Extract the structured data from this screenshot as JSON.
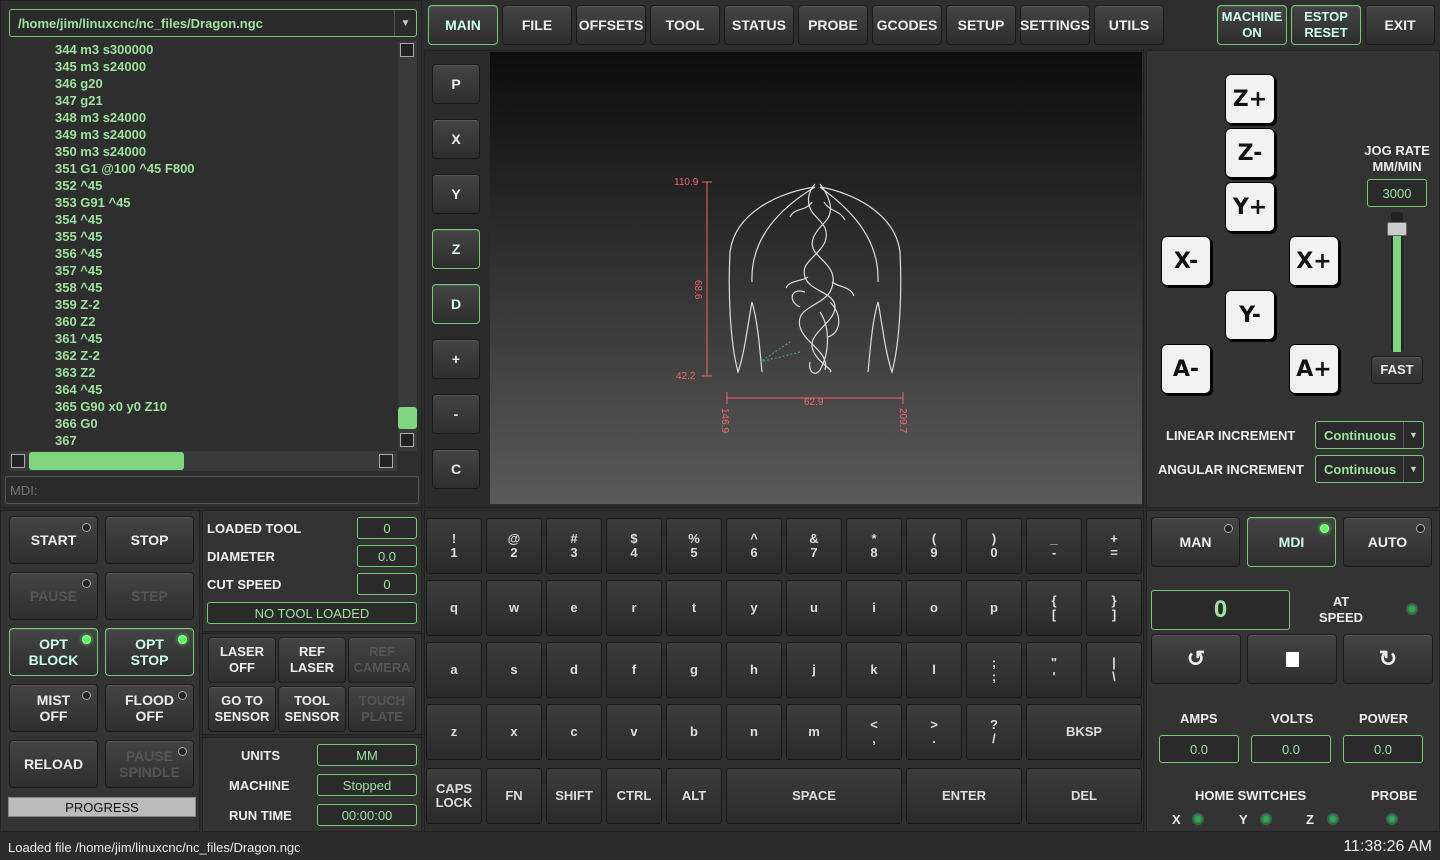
{
  "file": {
    "path": "/home/jim/linuxcnc/nc_files/Dragon.ngc"
  },
  "gcode": [
    "344 m3 s300000",
    "345 m3 s24000",
    "346 g20",
    "347 g21",
    "348 m3 s24000",
    "349 m3 s24000",
    "350 m3 s24000",
    "351 G1 @100 ^45 F800",
    "352 ^45",
    "353 G91 ^45",
    "354 ^45",
    "355 ^45",
    "356 ^45",
    "357 ^45",
    "358 ^45",
    "359 Z-2",
    "360 Z2",
    "361 ^45",
    "362 Z-2",
    "363 Z2",
    "364 ^45",
    "365 G90 x0 y0 Z10",
    "366 G0",
    "367"
  ],
  "mdi": {
    "placeholder": "MDI:"
  },
  "tabs": [
    "MAIN",
    "FILE",
    "OFFSETS",
    "TOOL",
    "STATUS",
    "PROBE",
    "GCODES",
    "SETUP",
    "SETTINGS",
    "UTILS"
  ],
  "machine_on": "MACHINE\nON",
  "estop_reset": "ESTOP\nRESET",
  "exit": "EXIT",
  "view_buttons": [
    "P",
    "X",
    "Y",
    "Z",
    "D",
    "+",
    "-",
    "C"
  ],
  "preview": {
    "dims": {
      "top": "110.9",
      "bottom": "42.2",
      "height": "68.6",
      "width": "62.9",
      "left": "146.9",
      "right": "209.7"
    }
  },
  "jog": {
    "rate_label": "JOG RATE\nMM/MIN",
    "rate": "3000",
    "fast": "FAST",
    "rate_fraction": 0.88,
    "zplus": "Z+",
    "zminus": "Z-",
    "yplus": "Y+",
    "yminus": "Y-",
    "xminus": "X-",
    "xplus": "X+",
    "aminus": "A-",
    "aplus": "A+",
    "linear_label": "LINEAR INCREMENT",
    "linear_value": "Continuous",
    "angular_label": "ANGULAR INCREMENT",
    "angular_value": "Continuous"
  },
  "controls": {
    "start": "START",
    "stop": "STOP",
    "pause": "PAUSE",
    "step": "STEP",
    "opt_block": "OPT\nBLOCK",
    "opt_stop": "OPT\nSTOP",
    "mist": "MIST\nOFF",
    "flood": "FLOOD\nOFF",
    "reload": "RELOAD",
    "pause_spindle": "PAUSE\nSPINDLE",
    "progress": "PROGRESS"
  },
  "tool": {
    "loaded_label": "LOADED TOOL",
    "loaded": "0",
    "diameter_label": "DIAMETER",
    "diameter": "0.0",
    "cut_label": "CUT SPEED",
    "cut": "0",
    "status": "NO TOOL LOADED"
  },
  "laser": {
    "laser_off": "LASER\nOFF",
    "ref_laser": "REF\nLASER",
    "ref_camera": "REF\nCAMERA",
    "go_sensor": "GO TO\nSENSOR",
    "tool_sensor": "TOOL\nSENSOR",
    "touch_plate": "TOUCH\nPLATE"
  },
  "status": {
    "units_label": "UNITS",
    "units": "MM",
    "machine_label": "MACHINE",
    "machine": "Stopped",
    "runtime_label": "RUN TIME",
    "runtime": "00:00:00"
  },
  "keyboard": {
    "row1": [
      "!\n1",
      "@\n2",
      "#\n3",
      "$\n4",
      "%\n5",
      "^\n6",
      "&\n7",
      "*\n8",
      "(\n9",
      ")\n0",
      "_\n-",
      "+\n="
    ],
    "row2": [
      "q",
      "w",
      "e",
      "r",
      "t",
      "y",
      "u",
      "i",
      "o",
      "p",
      "{\n[",
      "}\n]"
    ],
    "row3": [
      "a",
      "s",
      "d",
      "f",
      "g",
      "h",
      "j",
      "k",
      "l",
      ";\n;",
      "\"\n'",
      "|\n\\"
    ],
    "row4": [
      "z",
      "x",
      "c",
      "v",
      "b",
      "n",
      "m",
      "<\n,",
      ">\n.",
      "?\n/"
    ],
    "bksp": "BKSP",
    "row5": [
      "CAPS\nLOCK",
      "FN",
      "SHIFT",
      "CTRL",
      "ALT"
    ],
    "space": "SPACE",
    "enter": "ENTER",
    "del": "DEL"
  },
  "mode": {
    "man": "MAN",
    "mdi": "MDI",
    "auto": "AUTO"
  },
  "spindle": {
    "speed": "0",
    "at_speed": "AT\nSPEED"
  },
  "meters": {
    "amps_label": "AMPS",
    "amps": "0.0",
    "volts_label": "VOLTS",
    "volts": "0.0",
    "power_label": "POWER",
    "power": "0.0"
  },
  "home": {
    "label": "HOME SWITCHES",
    "x": "X",
    "y": "Y",
    "z": "Z",
    "probe": "PROBE"
  },
  "statusbar": {
    "message": "Loaded file /home/jim/linuxcnc/nc_files/Dragon.ngc",
    "time": "11:38:26 AM"
  }
}
